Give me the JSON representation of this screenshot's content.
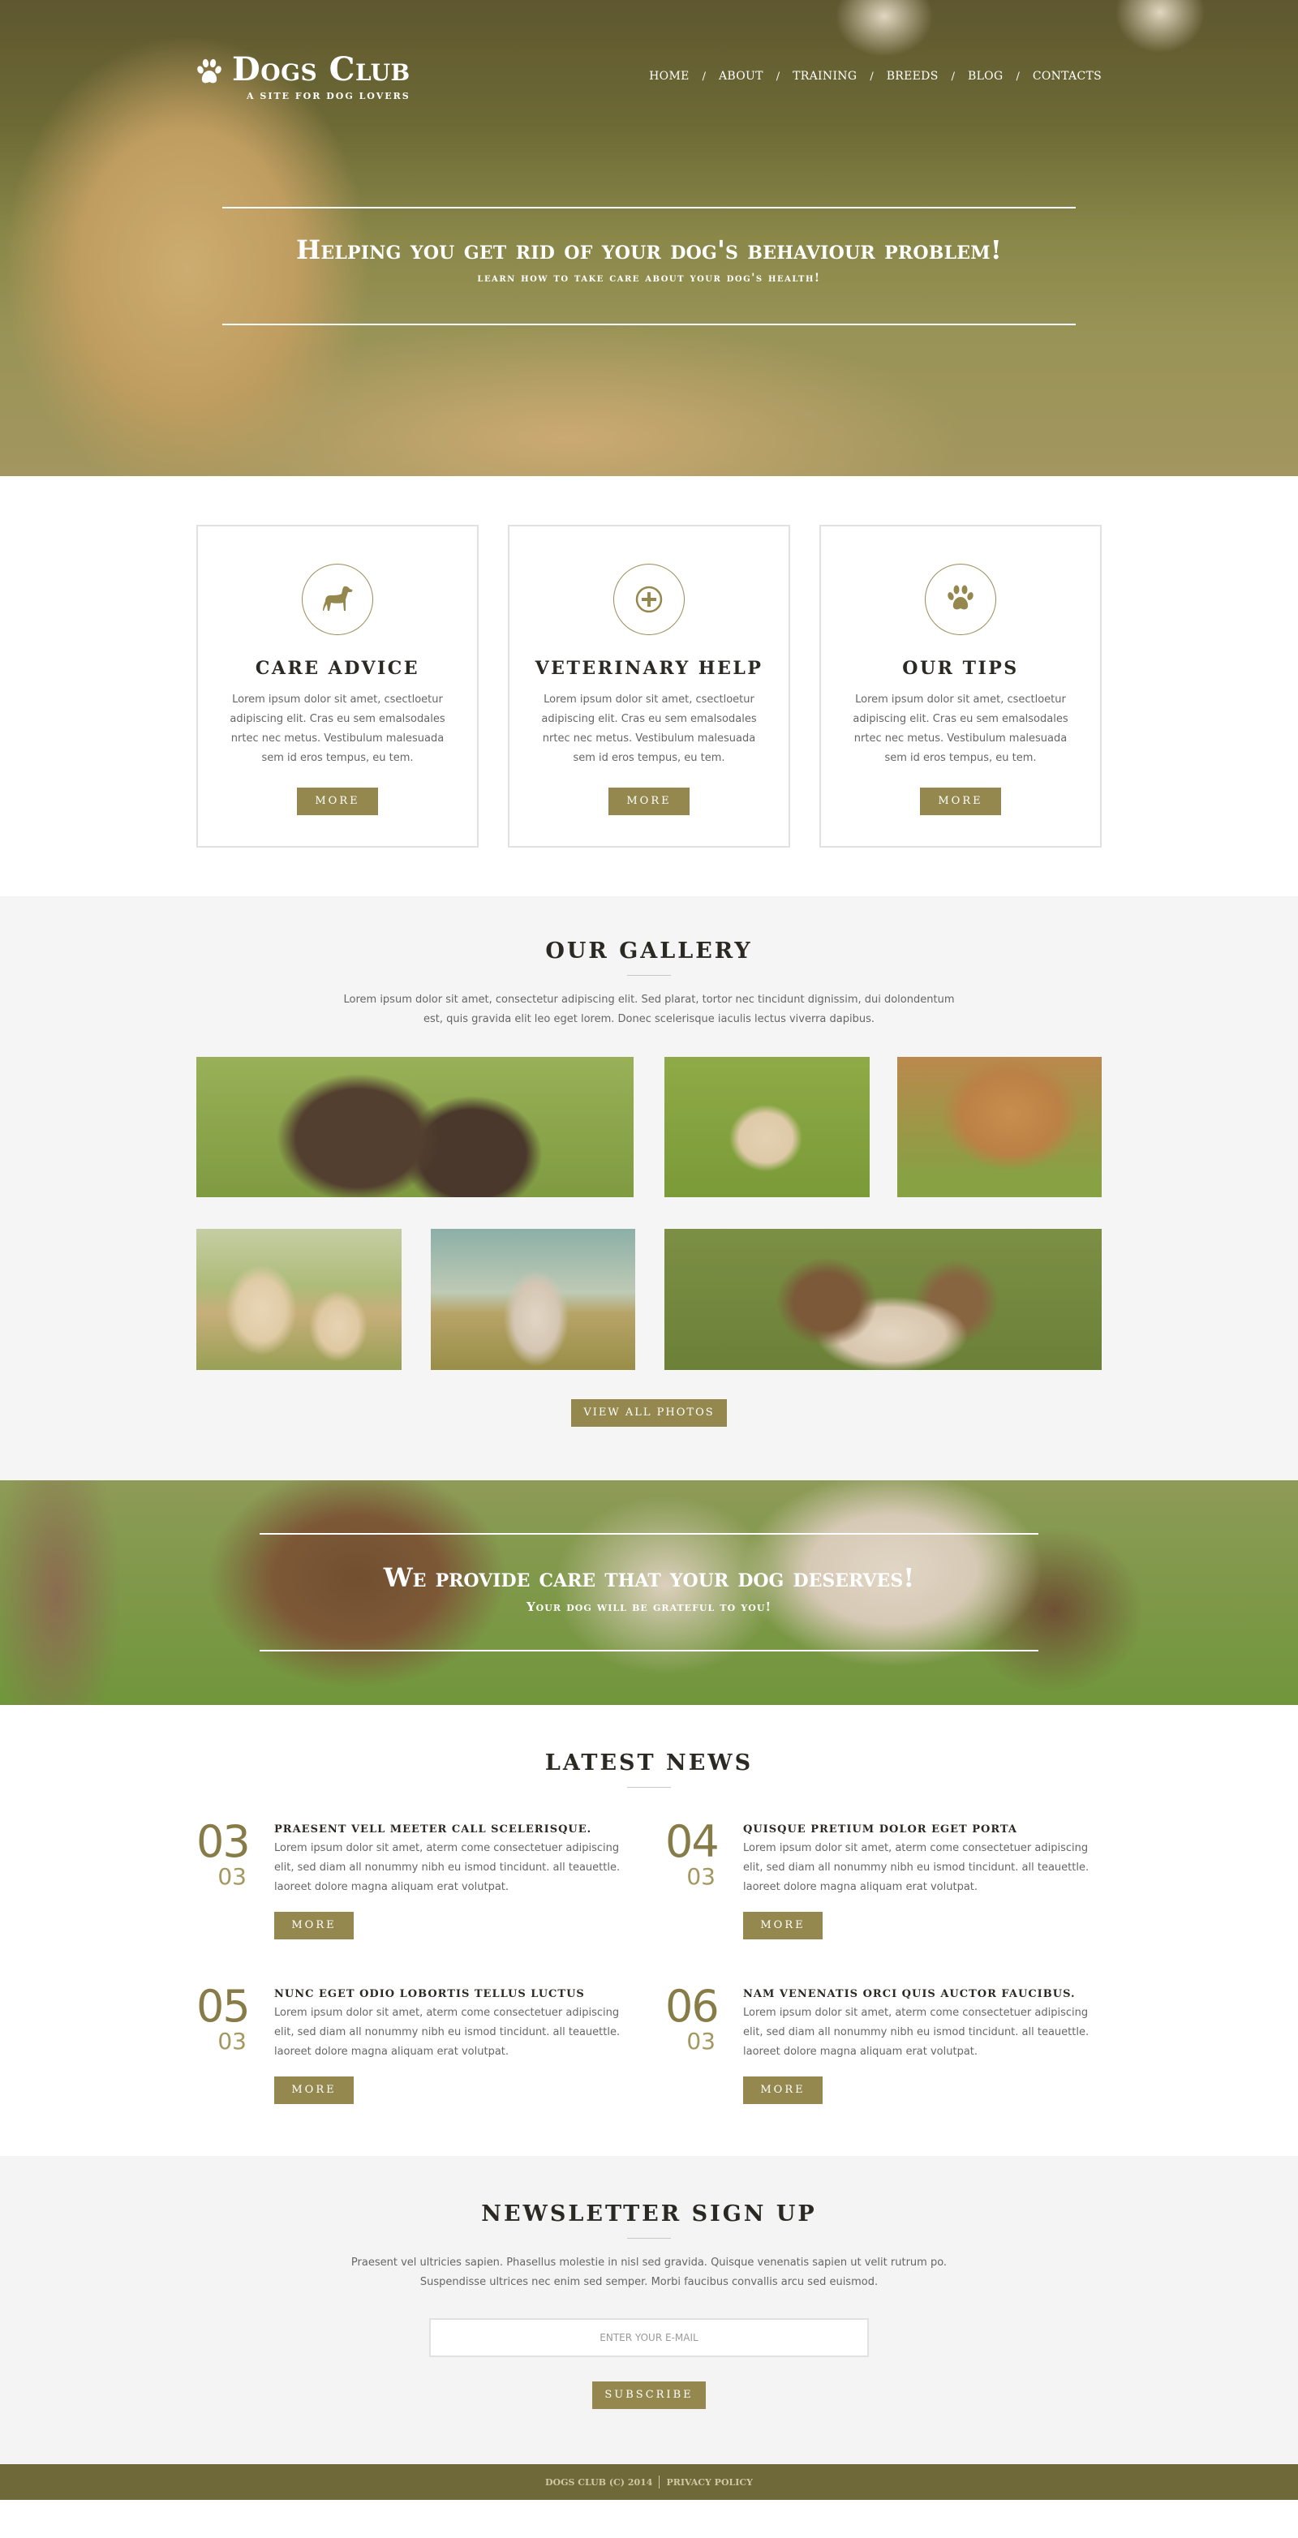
{
  "header": {
    "logo_title": "Dogs Club",
    "logo_tagline": "A SITE FOR DOG LOVERS",
    "nav": [
      {
        "label": "HOME"
      },
      {
        "label": "ABOUT"
      },
      {
        "label": "TRAINING"
      },
      {
        "label": "BREEDS"
      },
      {
        "label": "BLOG"
      },
      {
        "label": "CONTACTS"
      }
    ],
    "nav_separator": "/"
  },
  "hero": {
    "title": "Helping you get rid of your dog's behaviour problem!",
    "subtitle": "learn how to take care about your dog's health!"
  },
  "features": [
    {
      "icon": "dog-icon",
      "title": "CARE ADVICE",
      "text": "Lorem ipsum dolor sit amet, csectloetur adipiscing elit. Cras eu sem emalsodales nrtec nec metus. Vestibulum malesuada sem id eros tempus, eu tem.",
      "button": "MORE"
    },
    {
      "icon": "medical-cross-icon",
      "title": "VETERINARY HELP",
      "text": "Lorem ipsum dolor sit amet, csectloetur adipiscing elit. Cras eu sem emalsodales nrtec nec metus. Vestibulum malesuada sem id eros tempus, eu tem.",
      "button": "MORE"
    },
    {
      "icon": "paw-icon",
      "title": "OUR TIPS",
      "text": "Lorem ipsum dolor sit amet, csectloetur adipiscing elit. Cras eu sem emalsodales nrtec nec metus. Vestibulum malesuada sem id eros tempus, eu tem.",
      "button": "MORE"
    }
  ],
  "gallery": {
    "title": "OUR GALLERY",
    "text": "Lorem ipsum dolor sit amet, consectetur adipiscing elit. Sed plarat, tortor nec tincidunt dignissim, dui dolondentum est, quis gravida elit leo eget lorem. Donec scelerisque iaculis lectus viverra dapibus.",
    "photos": [
      {
        "subject": "two black labrador puppies in grass"
      },
      {
        "subject": "golden retriever puppy lying in grass"
      },
      {
        "subject": "golden retriever chewing green ball"
      },
      {
        "subject": "two yellow labrador puppies walking"
      },
      {
        "subject": "husky puppy in field"
      },
      {
        "subject": "shih tzu puppy in grass"
      }
    ],
    "button": "VIEW ALL PHOTOS"
  },
  "banner": {
    "title": "We provide care that your dog deserves!",
    "subtitle": "Your dog will be grateful to you!"
  },
  "news": {
    "title": "LATEST NEWS",
    "items": [
      {
        "day": "03",
        "month": "03",
        "title": "PRAESENT VELL  MEETER CALL SCELERISQUE.",
        "text": "Lorem ipsum dolor sit amet, aterm come consectetuer adipiscing elit, sed diam all nonummy nibh eu ismod  tincidunt. all teauettle. laoreet dolore magna aliquam erat volutpat.",
        "button": "MORE"
      },
      {
        "day": "04",
        "month": "03",
        "title": "QUISQUE PRETIUM DOLOR EGET PORTA",
        "text": "Lorem ipsum dolor sit amet, aterm come consectetuer adipiscing elit, sed diam all nonummy nibh eu ismod  tincidunt. all teauettle. laoreet dolore magna aliquam erat volutpat.",
        "button": "MORE"
      },
      {
        "day": "05",
        "month": "03",
        "title": "NUNC EGET ODIO LOBORTIS TELLUS LUCTUS",
        "text": "Lorem ipsum dolor sit amet, aterm come consectetuer adipiscing elit, sed diam all nonummy nibh eu ismod  tincidunt. all teauettle. laoreet dolore magna aliquam erat volutpat.",
        "button": "MORE"
      },
      {
        "day": "06",
        "month": "03",
        "title": "NAM VENENATIS ORCI QUIS AUCTOR FAUCIBUS.",
        "text": "Lorem ipsum dolor sit amet, aterm come consectetuer adipiscing elit, sed diam all nonummy nibh eu ismod  tincidunt. all teauettle. laoreet dolore magna aliquam erat volutpat.",
        "button": "MORE"
      }
    ]
  },
  "newsletter": {
    "title": "NEWSLETTER SIGN UP",
    "text": "Praesent vel ultricies sapien. Phasellus molestie in nisl sed gravida. Quisque venenatis sapien ut velit rutrum po. Suspendisse ultrices nec enim sed semper. Morbi faucibus convallis arcu sed euismod.",
    "email_placeholder": "ENTER YOUR E-MAIL",
    "email_value": "",
    "button": "SUBSCRIBE"
  },
  "footer": {
    "copyright": "DOGS CLUB (C) 2014",
    "privacy_link": "PRIVACY POLICY"
  },
  "colors": {
    "accent": "#94884e",
    "footer_bg": "#6f6838",
    "news_date": "#877c48",
    "heading": "#2b2924",
    "section_alt_bg": "#f5f5f5"
  }
}
